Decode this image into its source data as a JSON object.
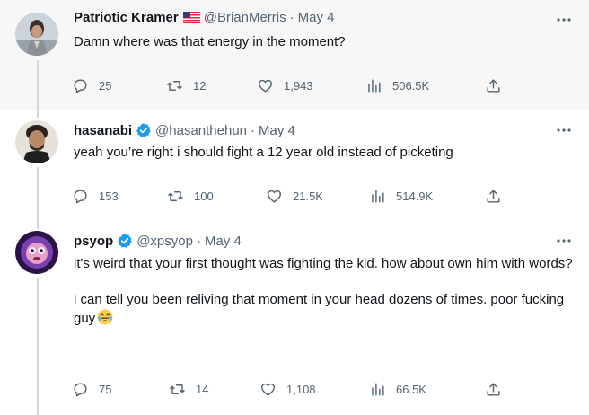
{
  "tweets": [
    {
      "name": "Patriotic Kramer",
      "handle": "@BrianMerris",
      "date": "May 4",
      "text": "Damn where was that energy in the moment?",
      "replies": "25",
      "retweets": "12",
      "likes": "1,943",
      "views": "506.5K"
    },
    {
      "name": "hasanabi",
      "handle": "@hasanthehun",
      "date": "May 4",
      "text": "yeah you’re right i should fight a 12 year old instead of picketing",
      "replies": "153",
      "retweets": "100",
      "likes": "21.5K",
      "views": "514.9K"
    },
    {
      "name": "psyop",
      "handle": "@xpsyop",
      "date": "May 4",
      "text_p1": "it's weird that your first thought was fighting the kid. how about own him with words?",
      "text_p2": "i can tell you been reliving that moment in your head dozens of times. poor fucking guy",
      "emoji": "face-with-tears-of-joy",
      "replies": "75",
      "retweets": "14",
      "likes": "1,108",
      "views": "66.5K"
    }
  ],
  "separator": "·",
  "colors": {
    "muted": "#536471",
    "verified": "#1d9bf0",
    "thread_line": "#cfd9de",
    "highlight_bg": "#f7f7f7"
  }
}
